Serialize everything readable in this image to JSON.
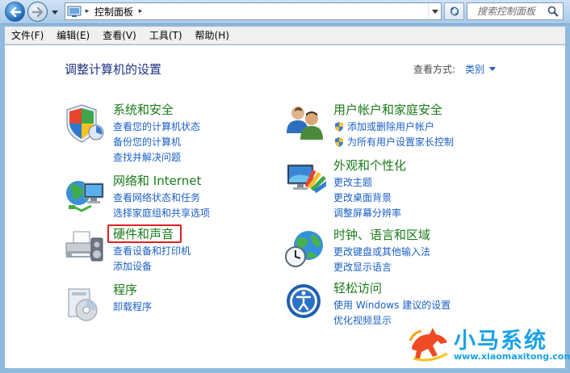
{
  "address_bar": {
    "crumbs": [
      "控制面板"
    ],
    "separator": "▸"
  },
  "search": {
    "placeholder": "搜索控制面板"
  },
  "menu": {
    "items": [
      "文件(F)",
      "编辑(E)",
      "查看(V)",
      "工具(T)",
      "帮助(H)"
    ]
  },
  "main": {
    "title": "调整计算机的设置",
    "view_by_label": "查看方式:",
    "view_by_value": "类别"
  },
  "categories": [
    {
      "title": "系统和安全",
      "icon": "shield-icon",
      "links": [
        "查看您的计算机状态",
        "备份您的计算机",
        "查找并解决问题"
      ]
    },
    {
      "title": "网络和 Internet",
      "icon": "network-globe-icon",
      "links": [
        "查看网络状态和任务",
        "选择家庭组和共享选项"
      ]
    },
    {
      "title": "硬件和声音",
      "icon": "printer-icon",
      "links": [
        "查看设备和打印机",
        "添加设备"
      ]
    },
    {
      "title": "程序",
      "icon": "programs-icon",
      "links": [
        "卸载程序"
      ]
    },
    {
      "title": "用户帐户和家庭安全",
      "icon": "users-icon",
      "links": [
        "添加或删除用户帐户",
        "为所有用户设置家长控制"
      ]
    },
    {
      "title": "外观和个性化",
      "icon": "appearance-icon",
      "links": [
        "更改主题",
        "更改桌面背景",
        "调整屏幕分辨率"
      ]
    },
    {
      "title": "时钟、语言和区域",
      "icon": "clock-globe-icon",
      "links": [
        "更改键盘或其他输入法",
        "更改显示语言"
      ]
    },
    {
      "title": "轻松访问",
      "icon": "ease-of-access-icon",
      "links": [
        "使用 Windows 建议的设置",
        "优化视频显示"
      ]
    }
  ],
  "watermark": {
    "title": "小马系统",
    "url": "www.xiaomaxitong.com"
  },
  "colors": {
    "category_title": "#1a7a1a",
    "link": "#1a5fc5",
    "page_title": "#1e3287",
    "highlight": "#e02020",
    "logo": "#19a1e6"
  }
}
